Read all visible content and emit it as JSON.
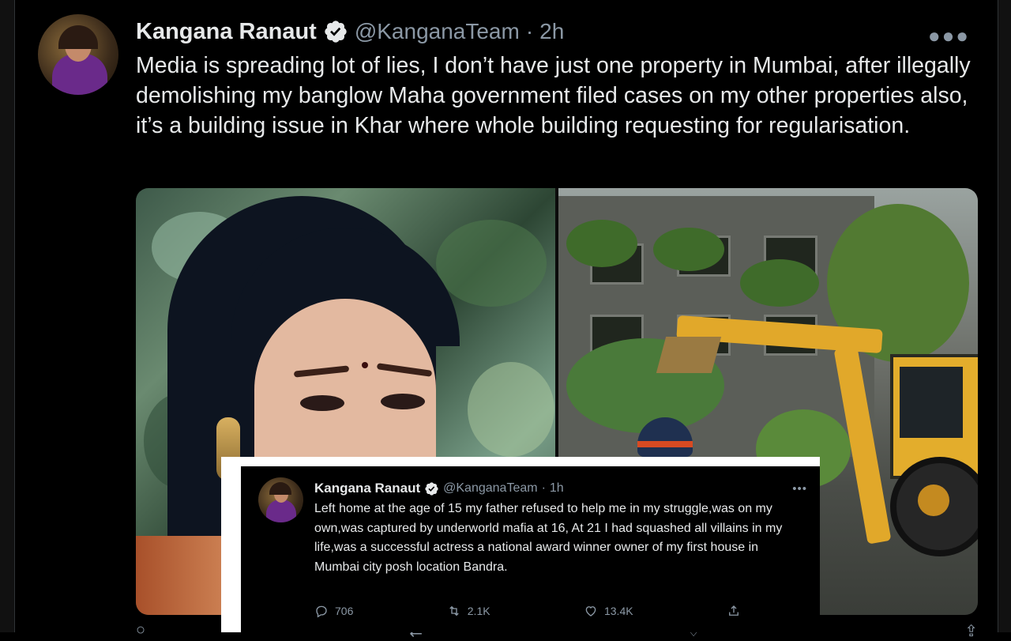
{
  "main_tweet": {
    "author_name": "Kangana Ranaut",
    "handle": "@KanganaTeam",
    "time": "2h",
    "separator": "·",
    "more_icon": "more-horizontal-icon",
    "text": "Media is spreading lot of lies, I don’t have just one property in Mumbai, after illegally demolishing my banglow Maha government filed cases on my other properties also, it’s a building issue in Khar where whole building requesting for regularisation.",
    "verified_color": "#ffffff"
  },
  "inset_tweet": {
    "author_name": "Kangana Ranaut",
    "handle": "@KanganaTeam",
    "time": "1h",
    "separator": "·",
    "text": "Left home at the age of 15 my father refused to help me in my struggle,was on my own,was captured by underworld mafia at 16, At 21 I had squashed all villains in my life,was a successful actress a national award winner owner of my first house in Mumbai city posh location Bandra.",
    "replies": "706",
    "retweets": "2.1K",
    "likes": "13.4K"
  },
  "colors": {
    "background": "#000000",
    "text": "#e7e9ea",
    "secondary": "#8b98a5"
  }
}
